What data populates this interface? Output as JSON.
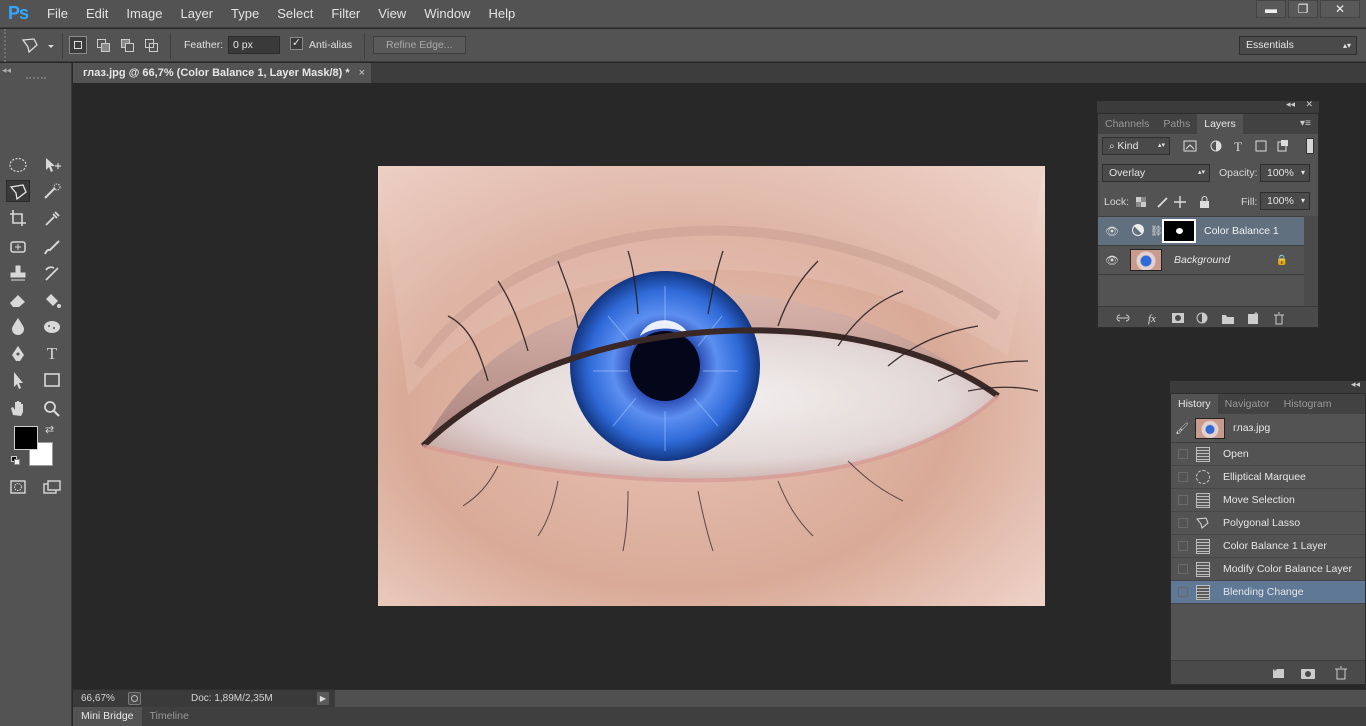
{
  "app": {
    "logo": "Ps",
    "menu": [
      "File",
      "Edit",
      "Image",
      "Layer",
      "Type",
      "Select",
      "Filter",
      "View",
      "Window",
      "Help"
    ],
    "window_controls": {
      "minimize": "▬",
      "restore": "❐",
      "close": "✕"
    }
  },
  "options": {
    "feather_label": "Feather:",
    "feather_value": "0 px",
    "antialias_label": "Anti-alias",
    "antialias_checked": true,
    "refine_edge_label": "Refine Edge...",
    "workspace": "Essentials"
  },
  "document": {
    "tab_title": "глаз.jpg @ 66,7% (Color Balance 1, Layer Mask/8) *",
    "close": "×",
    "zoom": "66,67%",
    "doc_size": "Doc: 1,89M/2,35M"
  },
  "bottom_tabs": [
    "Mini Bridge",
    "Timeline"
  ],
  "layers_panel": {
    "tabs": [
      "Channels",
      "Paths",
      "Layers"
    ],
    "active_tab": "Layers",
    "filter_kind": "Kind",
    "blend_mode": "Overlay",
    "opacity_label": "Opacity:",
    "opacity": "100%",
    "lock_label": "Lock:",
    "fill_label": "Fill:",
    "fill": "100%",
    "layers": [
      {
        "name": "Color Balance 1",
        "selected": true
      },
      {
        "name": "Background",
        "locked": true
      }
    ],
    "footer_fx": "fx"
  },
  "history_panel": {
    "tabs": [
      "History",
      "Navigator",
      "Histogram"
    ],
    "active_tab": "History",
    "snapshot": "глаз.jpg",
    "steps": [
      "Open",
      "Elliptical Marquee",
      "Move Selection",
      "Polygonal Lasso",
      "Color Balance 1 Layer",
      "Modify Color Balance Layer",
      "Blending Change"
    ],
    "selected_step": "Blending Change"
  },
  "colors": {
    "ui_panel": "#535353",
    "canvas_bg": "#282828",
    "selection": "#5f7895",
    "logo": "#31a8ff",
    "iris": "#2f6ad8"
  }
}
